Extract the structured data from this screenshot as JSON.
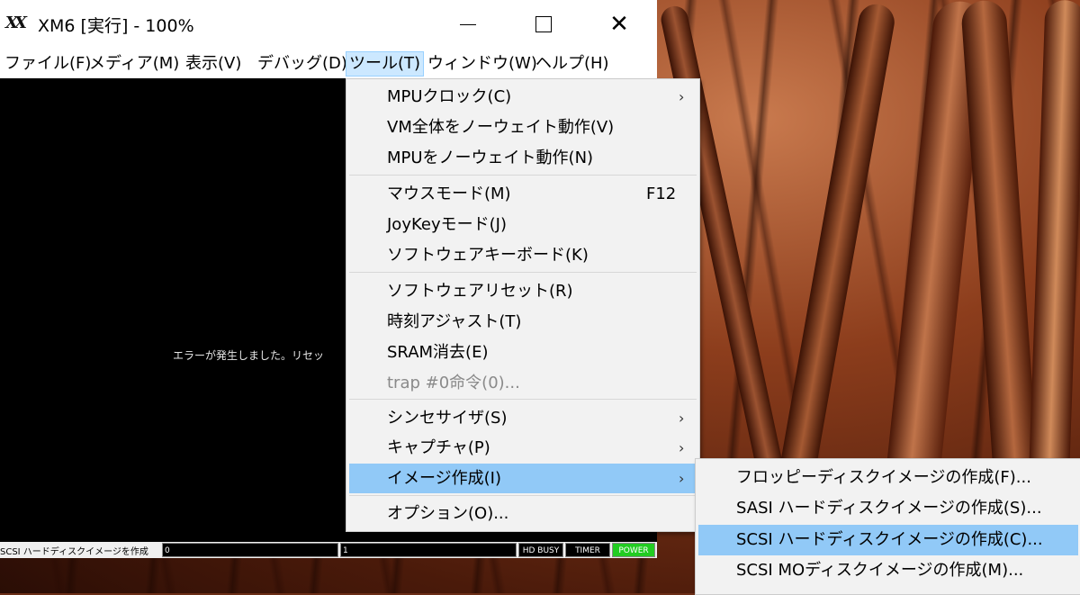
{
  "window": {
    "title": "XM6 [実行] - 100%",
    "icon": "xm6-logo-icon",
    "icon_text": "X"
  },
  "controls": {
    "minimize": "minimize-icon",
    "maximize": "maximize-icon",
    "close": "✕"
  },
  "menubar": {
    "items": [
      "ファイル(F)",
      "メディア(M)",
      "表示(V)",
      "デバッグ(D)",
      "ツール(T)",
      "ウィンドウ(W)",
      "ヘルプ(H)"
    ],
    "active": "ツール(T)"
  },
  "screen": {
    "message": "エラーが発生しました。リセッ"
  },
  "statusbar": {
    "message": "SCSI ハードディスクイメージを作成",
    "field1": "0",
    "field2": "1",
    "hd_busy": "HD BUSY",
    "timer": "TIMER",
    "power": "POWER"
  },
  "tools_menu": {
    "items": [
      {
        "label": "MPUクロック(C)",
        "has_submenu": true
      },
      {
        "label": "VM全体をノーウェイト動作(V)"
      },
      {
        "label": "MPUをノーウェイト動作(N)"
      },
      {
        "label": "マウスモード(M)",
        "shortcut": "F12"
      },
      {
        "label": "JoyKeyモード(J)"
      },
      {
        "label": "ソフトウェアキーボード(K)"
      },
      {
        "label": "ソフトウェアリセット(R)"
      },
      {
        "label": "時刻アジャスト(T)"
      },
      {
        "label": "SRAM消去(E)"
      },
      {
        "label": "trap #0命令(0)...",
        "disabled": true
      },
      {
        "label": "シンセサイザ(S)",
        "has_submenu": true
      },
      {
        "label": "キャプチャ(P)",
        "has_submenu": true
      },
      {
        "label": "イメージ作成(I)",
        "has_submenu": true,
        "highlighted": true
      },
      {
        "label": "オプション(O)..."
      }
    ],
    "submenu_arrow": "›"
  },
  "image_submenu": {
    "items": [
      {
        "label": "フロッピーディスクイメージの作成(F)..."
      },
      {
        "label": "SASI ハードディスクイメージの作成(S)..."
      },
      {
        "label": "SCSI ハードディスクイメージの作成(C)...",
        "highlighted": true
      },
      {
        "label": "SCSI MOディスクイメージの作成(M)..."
      }
    ]
  },
  "colors": {
    "menu_highlight": "#91c9f7",
    "menubar_active": "#cce8ff",
    "power_on": "#22cc22"
  }
}
